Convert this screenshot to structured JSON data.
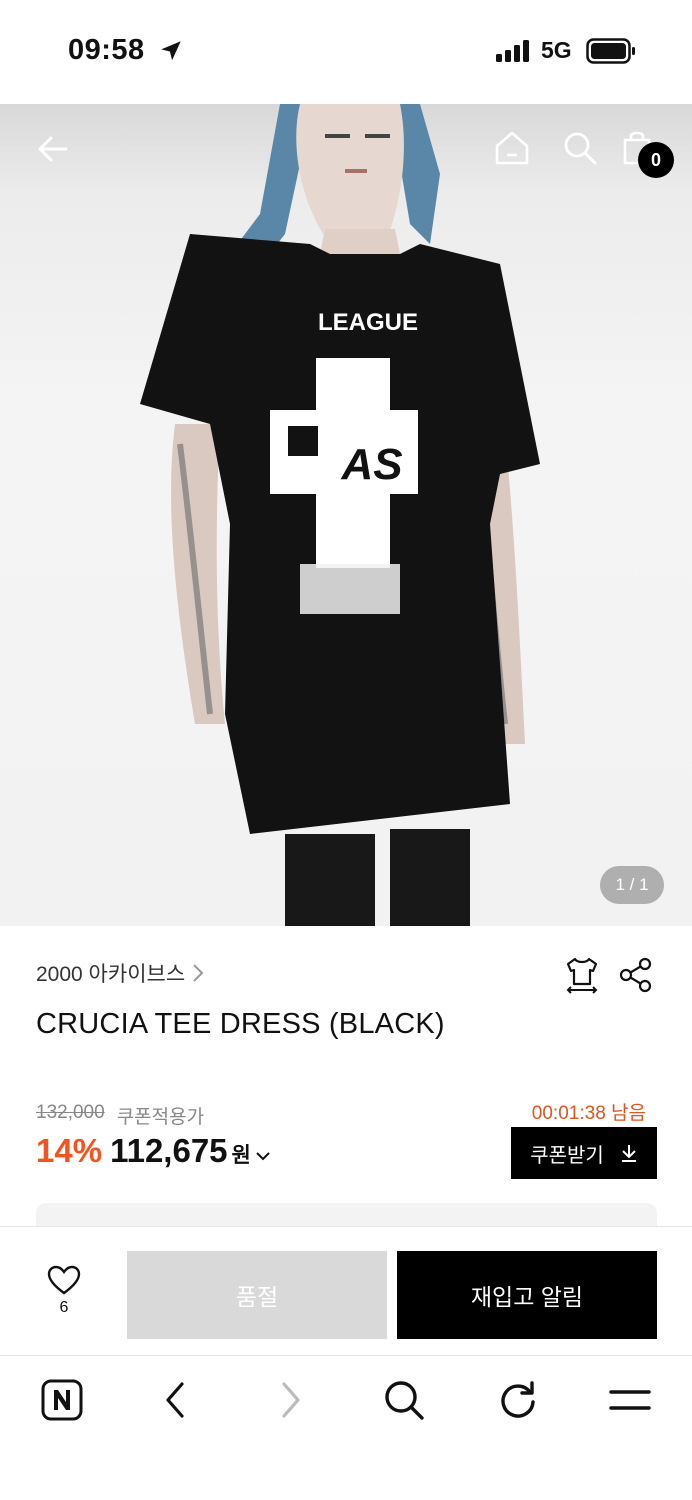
{
  "status_bar": {
    "time": "09:58",
    "network": "5G",
    "icons": [
      "location-arrow-icon",
      "signal-icon",
      "battery-icon"
    ]
  },
  "top_nav": {
    "icons": [
      "back-arrow-icon",
      "home-icon",
      "search-icon",
      "cart-icon"
    ],
    "cart_count": "0"
  },
  "gallery": {
    "counter": "1 / 1",
    "shirt_print": [
      "LEAGUE",
      "AS"
    ]
  },
  "product": {
    "brand": "2000 아카이브스",
    "name": "CRUCIA TEE DRESS (BLACK)",
    "original_price": "132,000",
    "coupon_label": "쿠폰적용가",
    "timer": "00:01:38 남음",
    "discount": "14%",
    "price": "112,675",
    "currency": "원",
    "coupon_button": "쿠폰받기",
    "icons": [
      "size-tshirt-icon",
      "share-icon"
    ]
  },
  "actions": {
    "like_count": "6",
    "soldout_label": "품절",
    "restock_label": "재입고 알림"
  },
  "browser_toolbar": {
    "icons": [
      "naver-n-icon",
      "back-icon",
      "forward-icon",
      "search-icon",
      "reload-icon",
      "menu-icon"
    ]
  },
  "colors": {
    "accent_orange": "#f2531f",
    "timer_orange": "#e0541f",
    "black": "#000000",
    "soldout_gray": "#d9d9d9"
  }
}
